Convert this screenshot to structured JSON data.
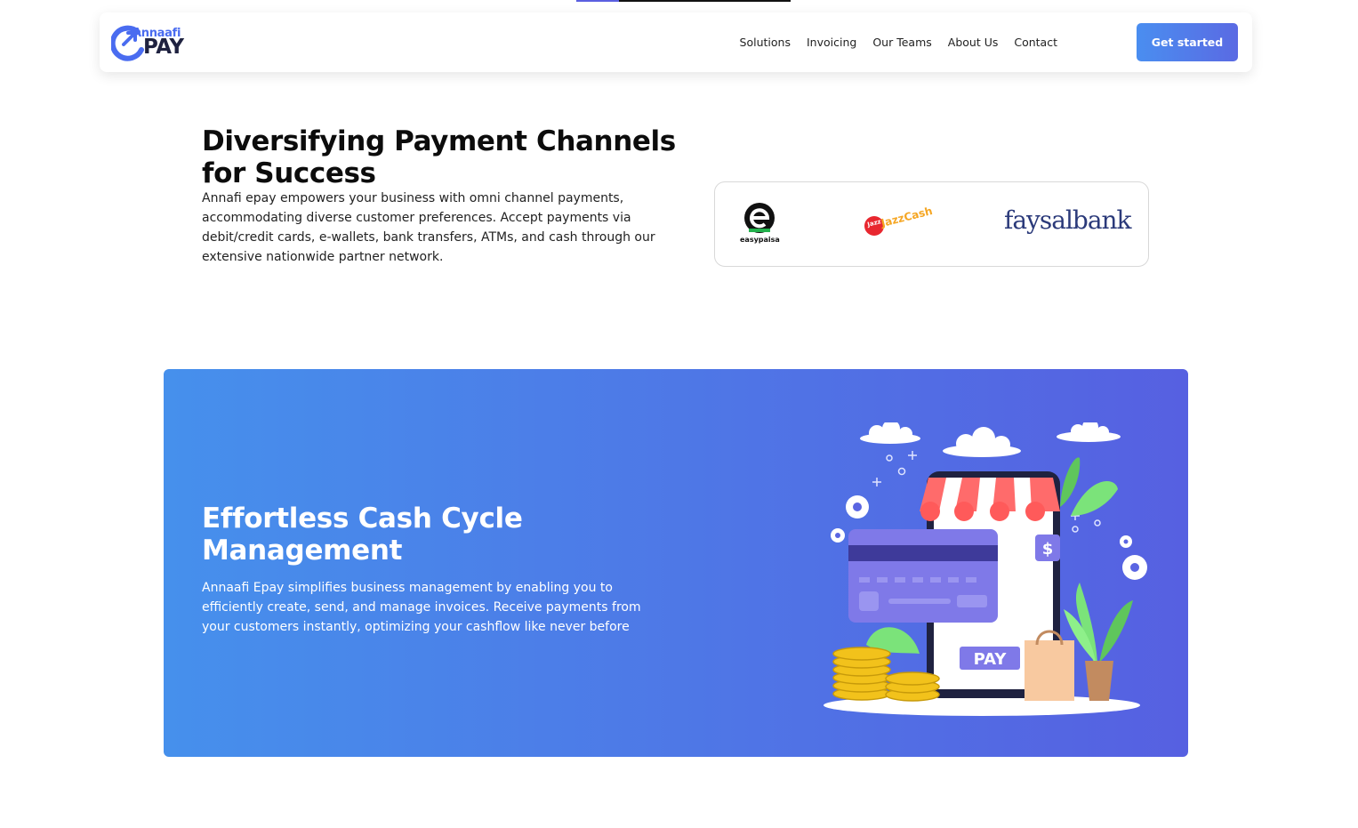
{
  "nav": {
    "brand_top": "Annaafi",
    "brand_bottom": "PAY",
    "links": [
      "Solutions",
      "Invoicing",
      "Our Teams",
      "About Us",
      "Contact"
    ],
    "cta_label": "Get started"
  },
  "hero": {
    "title": "Diversifying Payment Channels for Success",
    "description": "Annafi epay empowers your business with omni channel payments, accommodating diverse customer preferences. Accept payments via debit/credit cards, e-wallets, bank transfers, ATMs, and cash through our extensive nationwide partner network."
  },
  "partners": {
    "easypaisa": "easypaisa",
    "jazzcash": "JazzCash",
    "jazz_badge": "Jazz",
    "faysalbank": "faysalbank"
  },
  "banner": {
    "title": "Effortless Cash Cycle Management",
    "description": "Annaafi Epay simplifies business management by enabling you to efficiently create, send, and manage invoices. Receive payments from your customers instantly, optimizing your cashflow like never before",
    "illustration_label": "PAY"
  },
  "colors": {
    "brand_blue": "#4a6cf0",
    "banner_start": "#4690ec",
    "banner_end": "#5660e1",
    "faysal_navy": "#2b3a7a"
  }
}
